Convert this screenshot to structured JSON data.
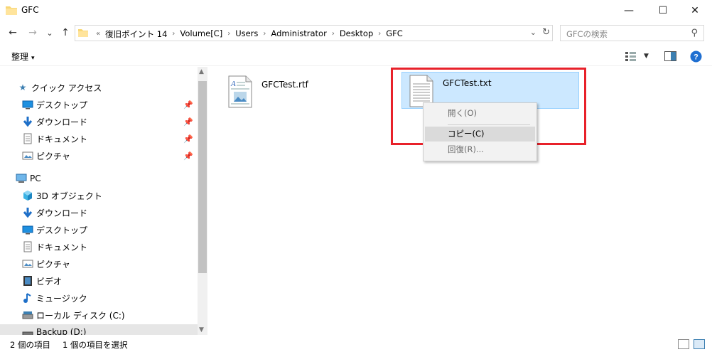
{
  "window": {
    "title": "GFC",
    "minimize": "—",
    "maximize": "☐",
    "close": "✕"
  },
  "nav": {
    "back": "←",
    "forward": "→",
    "recent": "⌄",
    "up": "↑"
  },
  "address": {
    "overflow": "«",
    "crumbs": [
      "復旧ポイント 14",
      "Volume[C]",
      "Users",
      "Administrator",
      "Desktop",
      "GFC"
    ],
    "separator": "›"
  },
  "search": {
    "placeholder": "GFCの検索"
  },
  "command": {
    "organize": "整理",
    "organize_caret": "▾"
  },
  "sidebar": {
    "items": [
      {
        "label": "クイック アクセス",
        "icon": "star-icon"
      },
      {
        "label": "デスクトップ",
        "icon": "desktop-icon",
        "pinned": true
      },
      {
        "label": "ダウンロード",
        "icon": "download-icon",
        "pinned": true
      },
      {
        "label": "ドキュメント",
        "icon": "document-icon",
        "pinned": true
      },
      {
        "label": "ピクチャ",
        "icon": "picture-icon",
        "pinned": true
      },
      {
        "label": "PC",
        "icon": "pc-icon"
      },
      {
        "label": "3D オブジェクト",
        "icon": "cube-icon"
      },
      {
        "label": "ダウンロード",
        "icon": "download-icon"
      },
      {
        "label": "デスクトップ",
        "icon": "desktop-icon"
      },
      {
        "label": "ドキュメント",
        "icon": "document-icon"
      },
      {
        "label": "ピクチャ",
        "icon": "picture-icon"
      },
      {
        "label": "ビデオ",
        "icon": "video-icon"
      },
      {
        "label": "ミュージック",
        "icon": "music-icon"
      },
      {
        "label": "ローカル ディスク (C:)",
        "icon": "drive-icon"
      },
      {
        "label": "Backup (D:)",
        "icon": "drive-icon"
      }
    ]
  },
  "files": [
    {
      "name": "GFCTest.rtf",
      "icon": "rtf-file-icon",
      "selected": false
    },
    {
      "name": "GFCTest.txt",
      "icon": "txt-file-icon",
      "selected": true
    }
  ],
  "context_menu": {
    "items": [
      {
        "label": "開く(O)",
        "enabled": false
      },
      {
        "label": "コピー(C)",
        "enabled": true,
        "highlighted": true
      },
      {
        "label": "回復(R)...",
        "enabled": false
      }
    ]
  },
  "status": {
    "item_count": "2 個の項目",
    "selected_count": "1 個の項目を選択"
  },
  "colors": {
    "highlight_box": "#e8212a",
    "selection_bg": "#cce8ff",
    "help_blue": "#1f6fd1"
  }
}
